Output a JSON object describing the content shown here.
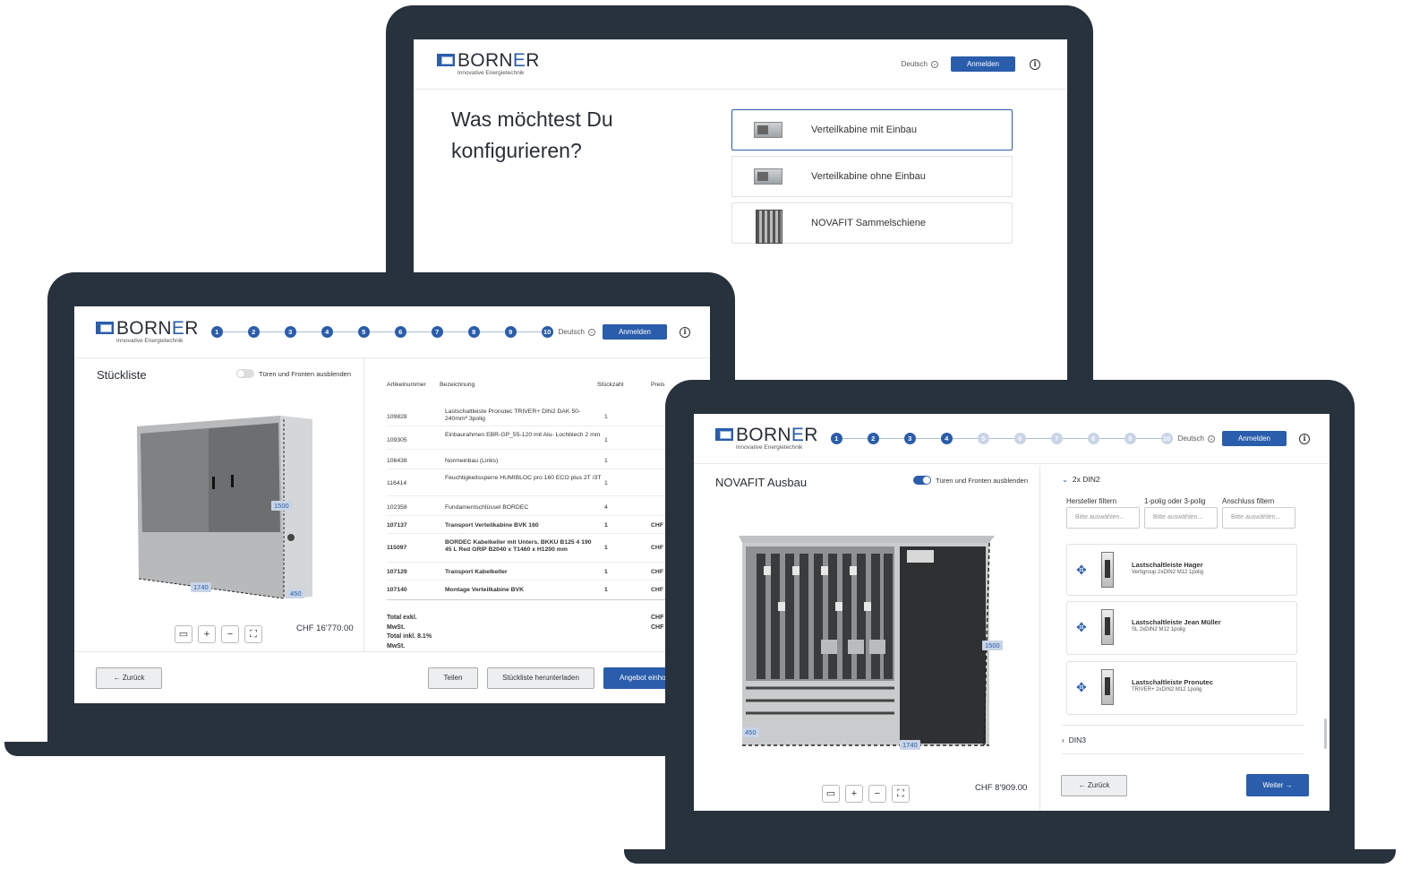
{
  "brand": {
    "name_pre": "BORN",
    "name_accent": "E",
    "name_post": "R",
    "tagline": "Innovative Energietechnik",
    "color": "#2a5dab"
  },
  "header": {
    "language": "Deutsch",
    "login": "Anmelden",
    "info": "i"
  },
  "laptop1": {
    "title": "Was möchtest Du konfigurieren?",
    "options": [
      {
        "label": "Verteilkabine mit Einbau",
        "selected": true
      },
      {
        "label": "Verteilkabine ohne Einbau",
        "selected": false
      },
      {
        "label": "NOVAFIT Sammelschiene",
        "selected": false
      }
    ]
  },
  "laptop2": {
    "steps": [
      "1",
      "2",
      "3",
      "4",
      "5",
      "6",
      "7",
      "8",
      "9",
      "10"
    ],
    "panel_title": "Stückliste",
    "toggle_label": "Türen und Fronten ausblenden",
    "dims": {
      "height": "1500",
      "width": "1740",
      "depth": "450"
    },
    "price": "CHF 16'770.00",
    "table": {
      "headers": {
        "article": "Artikelnummer",
        "desc": "Bezeichnung",
        "qty": "Stückzahl",
        "price": "Preis"
      },
      "rows": [
        {
          "article": "109828",
          "desc": "Lastschaltleiste Pronutec TRIVER+ DIN2 DAK 50-240mm² 3polig",
          "qty": "1",
          "price": "",
          "bold": false
        },
        {
          "article": "109305",
          "desc": "Einbaurahmen EBR-GP_55-120 mit Alu- Lochblech 2 mm",
          "qty": "1",
          "price": "",
          "bold": false
        },
        {
          "article": "106438",
          "desc": "Normeinbau (Links)",
          "qty": "1",
          "price": "",
          "bold": false
        },
        {
          "article": "116414",
          "desc": "Feuchtigkeitssperre HUMIBLOC pro 160 ECO plus 2T /3T",
          "qty": "1",
          "price": "",
          "bold": false
        },
        {
          "article": "102358",
          "desc": "Fundamentschlüssel BORDEC",
          "qty": "4",
          "price": "",
          "bold": false
        },
        {
          "article": "107137",
          "desc": "Transport Verteilkabine BVK 160",
          "qty": "1",
          "price": "CHF",
          "bold": true
        },
        {
          "article": "115097",
          "desc": "BORDEC Kabelkeller mit Unters. BKKU B125 4 190 45 L Red GRIP B2040 x T1460 x H1200 mm",
          "qty": "1",
          "price": "CHF",
          "bold": true
        },
        {
          "article": "107129",
          "desc": "Transport Kabelkeller",
          "qty": "1",
          "price": "CHF",
          "bold": true
        },
        {
          "article": "107140",
          "desc": "Montage Verteilkabine BVK",
          "qty": "1",
          "price": "CHF",
          "bold": true
        }
      ],
      "totals": [
        {
          "label": "Total exkl.",
          "value": "CHF"
        },
        {
          "label": "MwSt.",
          "value": "CHF"
        },
        {
          "label": "Total inkl. 8.1%",
          "value": ""
        },
        {
          "label": "MwSt.",
          "value": ""
        }
      ]
    },
    "footer": {
      "back": "← Zurück",
      "share": "Teilen",
      "download": "Stückliste herunterladen",
      "offer": "Angebot einhol"
    }
  },
  "laptop3": {
    "steps": [
      "1",
      "2",
      "3",
      "4",
      "5",
      "6",
      "7",
      "8",
      "9",
      "10"
    ],
    "active_steps": 4,
    "panel_title": "NOVAFIT Ausbau",
    "toggle_label": "Türen und Fronten ausblenden",
    "dims": {
      "height": "1500",
      "width": "1740",
      "depth": "450"
    },
    "price": "CHF 8'909.00",
    "section_open": "2x DIN2",
    "filters": [
      {
        "label": "Hersteller filtern",
        "placeholder": "Bitte auswählen..."
      },
      {
        "label": "1-polig oder 3-polig",
        "placeholder": "Bitte auswählen..."
      },
      {
        "label": "Anschluss filtern",
        "placeholder": "Bitte auswählen..."
      }
    ],
    "cards": [
      {
        "title": "Lastschaltleiste Hager",
        "sub": "Vertigroup 2xDIN2 M12 1polig"
      },
      {
        "title": "Lastschaltleiste Jean Müller",
        "sub": "SL 2xDIN2 M12 1polig"
      },
      {
        "title": "Lastschaltleiste Pronutec",
        "sub": "TRIVER+ 2xDIN2 M12 1polig"
      }
    ],
    "section_closed": "DIN3",
    "footer": {
      "back": "← Zurück",
      "next": "Weiter →"
    }
  }
}
